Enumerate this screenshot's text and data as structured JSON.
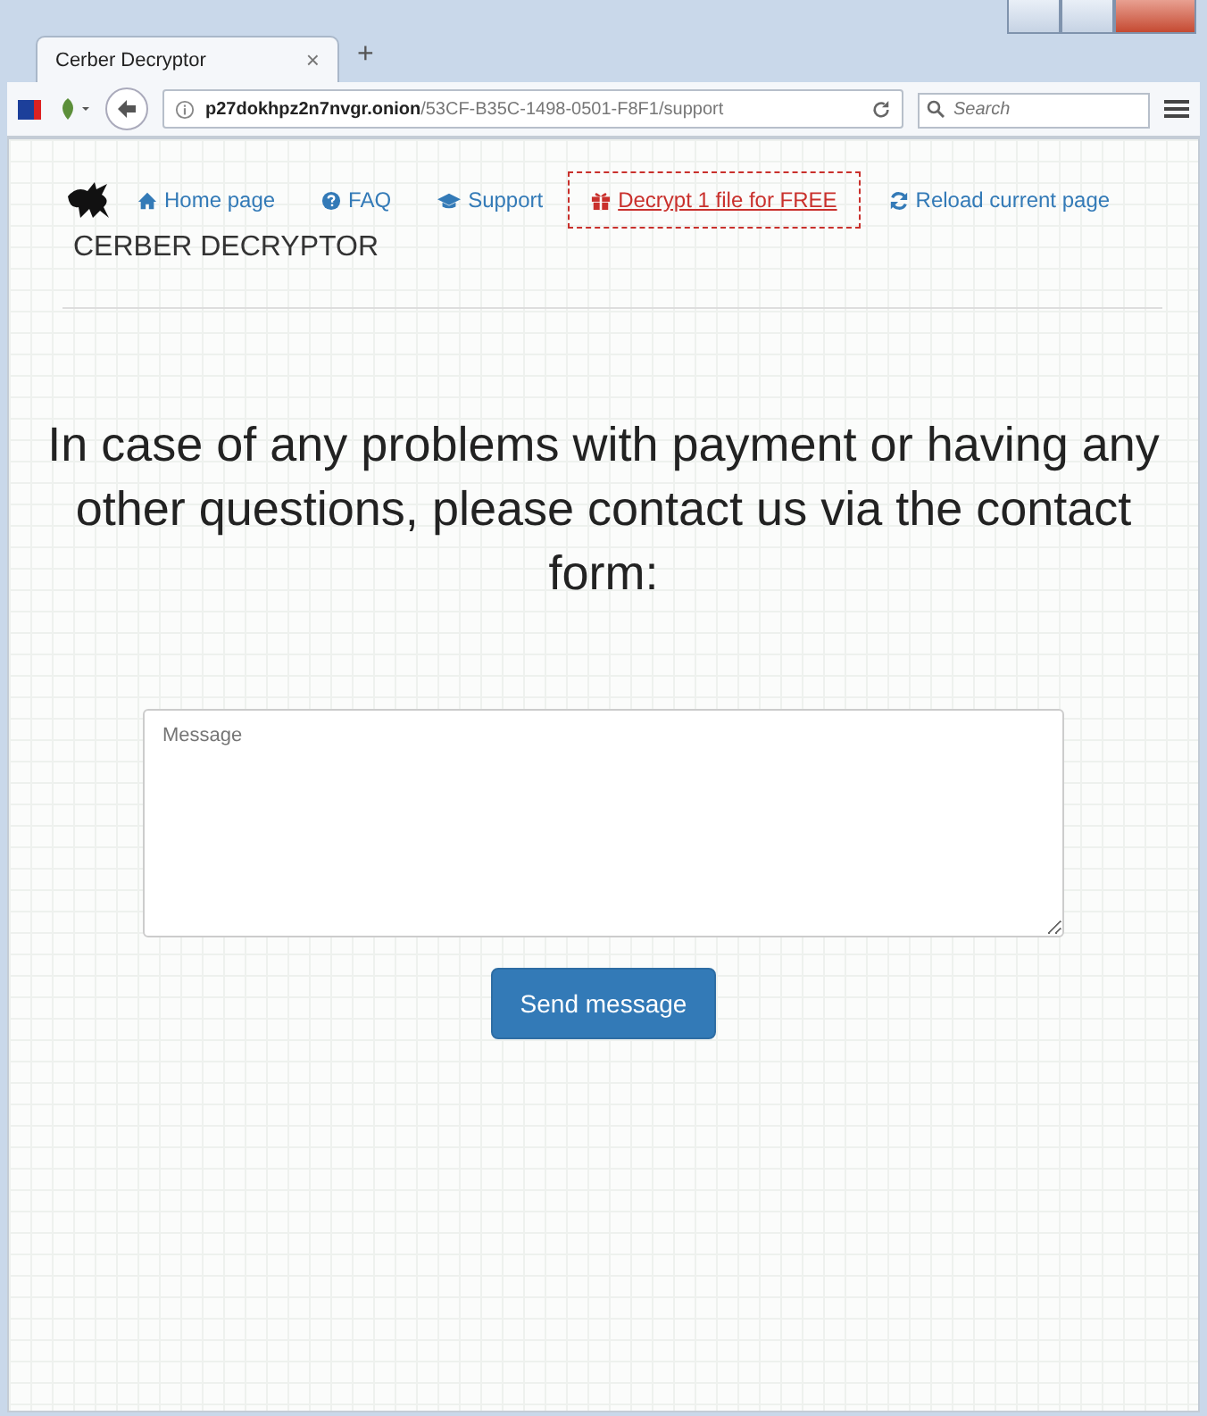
{
  "browser": {
    "tab_title": "Cerber Decryptor",
    "new_tab": "+",
    "tab_close": "×",
    "address": "**p27dokhpz2n7nvgr.onion**/53CF-B35C-1498-0501-F8F1/support",
    "search": {
      "placeholder": "Search"
    }
  },
  "site": {
    "title": "CERBER DECRYPTOR",
    "nav": [
      {
        "label": "Home page",
        "kind": "home",
        "highlighted": false
      },
      {
        "label": "FAQ",
        "kind": "faq",
        "highlighted": false
      },
      {
        "label": "Support",
        "kind": "support",
        "highlighted": false
      },
      {
        "label": "Decrypt 1 file for FREE",
        "kind": "gift",
        "highlighted": true
      },
      {
        "label": "Reload current page",
        "kind": "reload",
        "highlighted": false
      }
    ]
  },
  "support": {
    "heading": "In case of any problems with payment or having any other questions, please contact us via the contact form:",
    "message": {
      "placeholder": "Message"
    },
    "button": "Send message"
  }
}
